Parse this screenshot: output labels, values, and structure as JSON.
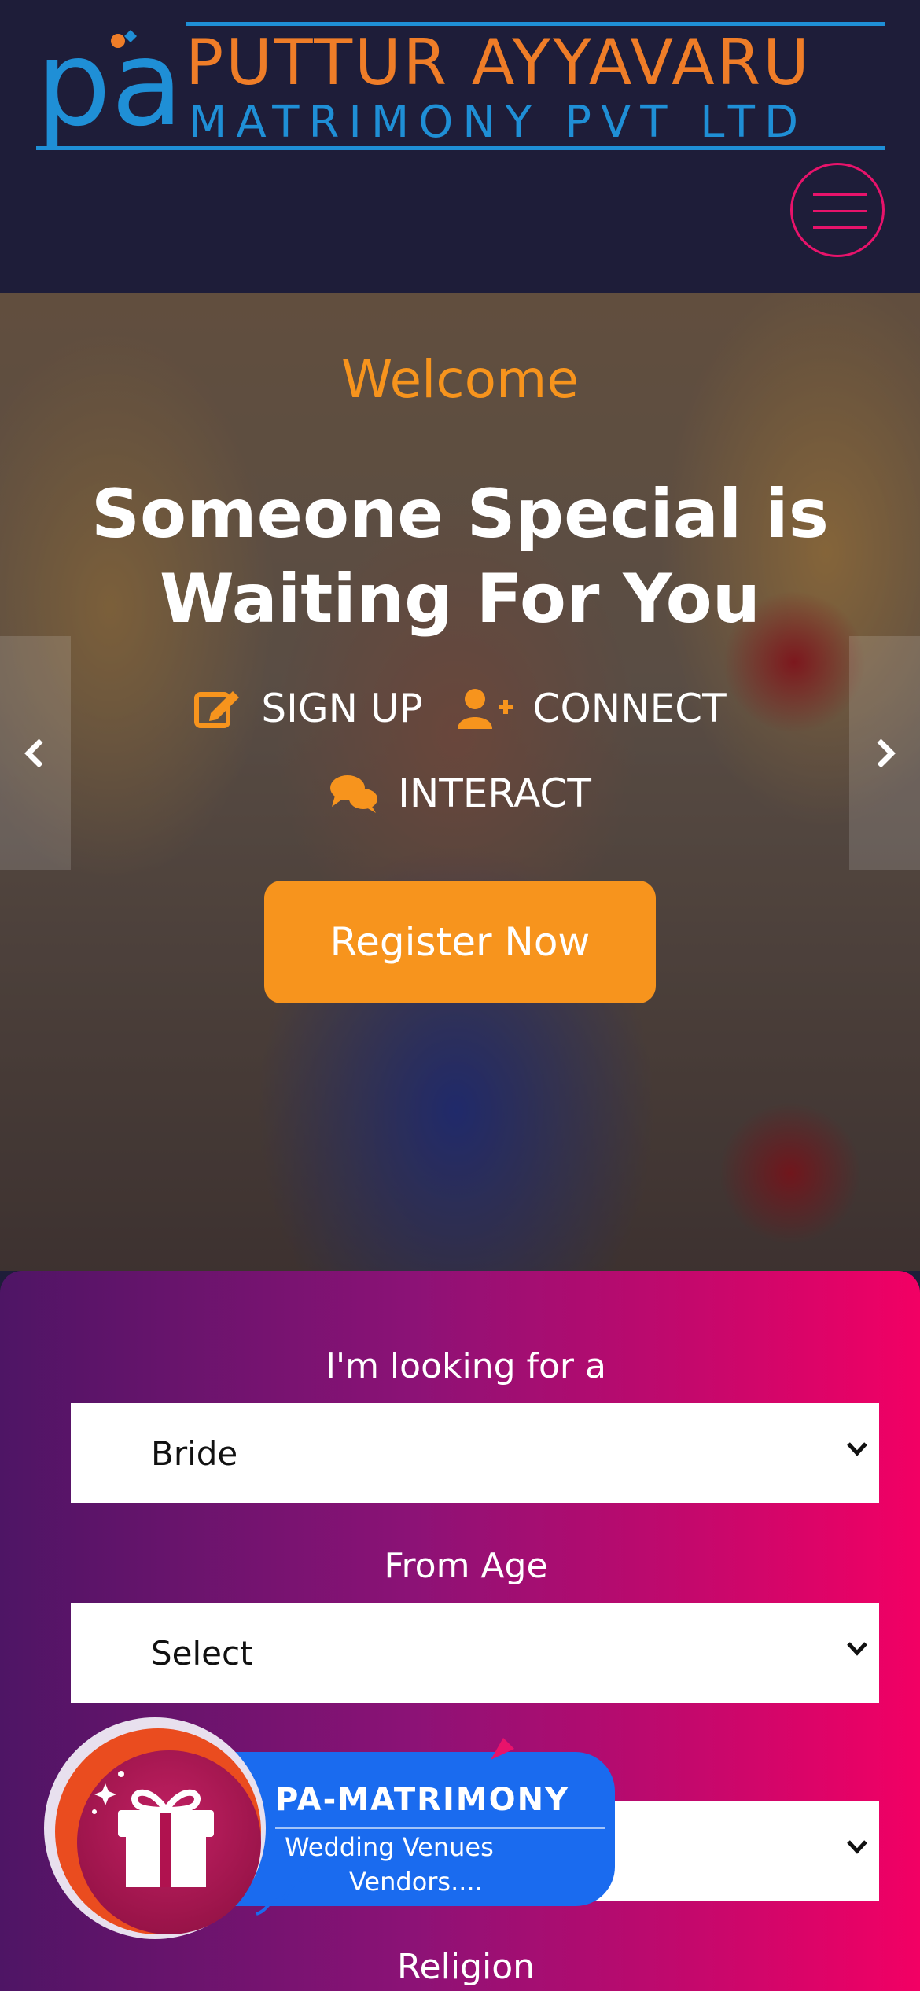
{
  "header": {
    "logo_line1": "PUTTUR AYYAVARU",
    "logo_line2": "MATRIMONY PVT LTD",
    "logo_mark_text": "pa",
    "menu_icon": "hamburger-icon"
  },
  "hero": {
    "welcome": "Welcome",
    "title": "Someone Special is Waiting For You",
    "features": [
      {
        "label": "SIGN UP",
        "icon": "edit-icon"
      },
      {
        "label": "CONNECT",
        "icon": "user-plus-icon"
      },
      {
        "label": "INTERACT",
        "icon": "comments-icon"
      }
    ],
    "cta_label": "Register Now",
    "prev_icon": "chevron-left-icon",
    "next_icon": "chevron-right-icon"
  },
  "search": {
    "looking_for_label": "I'm looking for a",
    "looking_for_value": "Bride",
    "from_age_label": "From Age",
    "from_age_value": "Select",
    "religion_label": "Religion"
  },
  "promo": {
    "title": "PA-MATRIMONY",
    "line1": "Wedding Venues",
    "line2": "Vendors....",
    "icon": "gift-icon"
  },
  "colors": {
    "header_bg": "#1e1d39",
    "accent_orange": "#f7941d",
    "logo_blue": "#1f8fd6",
    "menu_pink": "#e8136b",
    "panel_gradient_start": "#4e1565",
    "panel_gradient_end": "#f20064",
    "promo_blue": "#1a6bef"
  }
}
